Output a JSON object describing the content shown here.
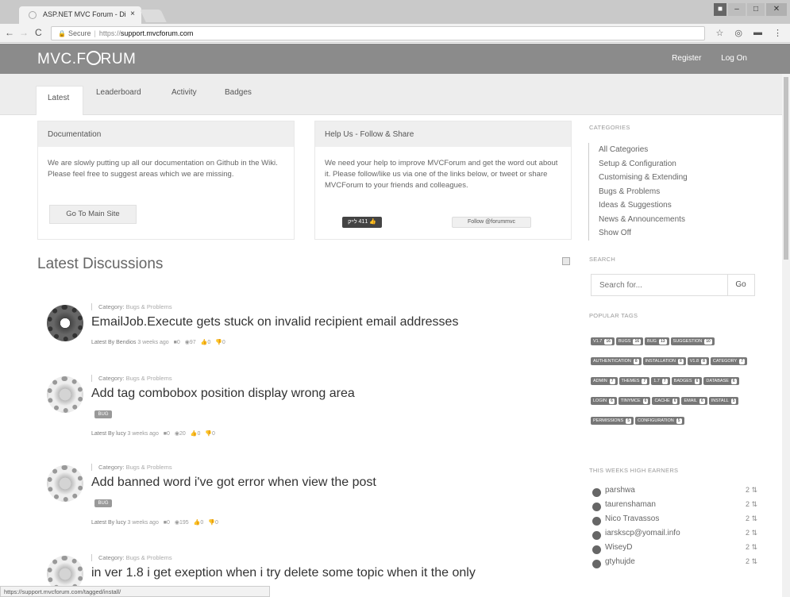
{
  "browser": {
    "tab_title": "ASP.NET MVC Forum - Di",
    "close": "×",
    "security_label": "Secure",
    "url_protocol": "https://",
    "url_host": "support.mvcforum.com",
    "status_url": "https://support.mvcforum.com/tagged/install/"
  },
  "header": {
    "logo_left": "MVC.F",
    "logo_right": "RUM",
    "register": "Register",
    "logon": "Log On"
  },
  "tabs": [
    "Latest",
    "Leaderboard",
    "Activity",
    "Badges"
  ],
  "documentation": {
    "title": "Documentation",
    "text": "We are slowly putting up all our documentation on Github in the Wiki. Please feel free to suggest areas which we are missing.",
    "button": "Go To Main Site"
  },
  "helpus": {
    "title": "Help Us - Follow & Share",
    "text": "We need your help to improve MVCForum and get the word out about it. Please follow/like us via one of the links below, or tweet or share MVCForum to your friends and colleagues.",
    "like": "‏411 לייק 👍",
    "follow": "Follow @forummvc"
  },
  "latest": {
    "heading": "Latest Discussions",
    "posts": [
      {
        "category_prefix": "Category:",
        "category": "Bugs & Problems",
        "title": "EmailJob.Execute gets stuck on invalid recipient email addresses",
        "tag": "",
        "meta_by": "Latest By Bendios",
        "meta_time": "3 weeks ago",
        "comments": "0",
        "views": "97",
        "likes": "0",
        "dislikes": "0"
      },
      {
        "category_prefix": "Category:",
        "category": "Bugs & Problems",
        "title": "Add tag combobox position display wrong area",
        "tag": "BUG",
        "meta_by": "Latest By lucy",
        "meta_time": "3 weeks ago",
        "comments": "0",
        "views": "20",
        "likes": "0",
        "dislikes": "0"
      },
      {
        "category_prefix": "Category:",
        "category": "Bugs & Problems",
        "title": "Add banned word i've got error when view the post",
        "tag": "BUG",
        "meta_by": "Latest By lucy",
        "meta_time": "3 weeks ago",
        "comments": "0",
        "views": "195",
        "likes": "0",
        "dislikes": "0"
      },
      {
        "category_prefix": "Category:",
        "category": "Bugs & Problems",
        "title": "in ver 1.8 i get exeption when i try delete some topic when it the only",
        "tag": "",
        "meta_by": "",
        "meta_time": "",
        "comments": "",
        "views": "",
        "likes": "",
        "dislikes": ""
      }
    ]
  },
  "sidebar": {
    "categories_heading": "CATEGORIES",
    "categories": [
      "All Categories",
      "Setup & Configuration",
      "Customising & Extending",
      "Bugs & Problems",
      "Ideas & Suggestions",
      "News & Announcements",
      "Show Off"
    ],
    "search_heading": "SEARCH",
    "search_placeholder": "Search for...",
    "search_go": "Go",
    "tags_heading": "POPULAR TAGS",
    "tags": [
      {
        "name": "V1.7",
        "count": "16"
      },
      {
        "name": "BUGS",
        "count": "16"
      },
      {
        "name": "BUG",
        "count": "13"
      },
      {
        "name": "SUGGESTION",
        "count": "10"
      },
      {
        "name": "AUTHENTICATION",
        "count": "8"
      },
      {
        "name": "INSTALLATION",
        "count": "8"
      },
      {
        "name": "V1.8",
        "count": "8"
      },
      {
        "name": "CATEGORY",
        "count": "7"
      },
      {
        "name": "ADMIN",
        "count": "7"
      },
      {
        "name": "THEMES",
        "count": "7"
      },
      {
        "name": "1.7",
        "count": "7"
      },
      {
        "name": "BADGES",
        "count": "6"
      },
      {
        "name": "DATABASE",
        "count": "6"
      },
      {
        "name": "LOGIN",
        "count": "6"
      },
      {
        "name": "TINYMCE",
        "count": "6"
      },
      {
        "name": "CACHE",
        "count": "6"
      },
      {
        "name": "EMAIL",
        "count": "6"
      },
      {
        "name": "INSTALL",
        "count": "5"
      },
      {
        "name": "PERMISSIONS",
        "count": "5"
      },
      {
        "name": "CONFIGURATION",
        "count": "5"
      }
    ],
    "earners_heading": "THIS WEEKS HIGH EARNERS",
    "earners": [
      {
        "name": "parshwa",
        "points": "2 ⇅"
      },
      {
        "name": "taurenshaman",
        "points": "2 ⇅"
      },
      {
        "name": "Nico Travassos",
        "points": "2 ⇅"
      },
      {
        "name": "iarskscp@yomail.info",
        "points": "2 ⇅"
      },
      {
        "name": "WiseyD",
        "points": "2 ⇅"
      },
      {
        "name": "gtyhujde",
        "points": "2 ⇅"
      }
    ]
  }
}
